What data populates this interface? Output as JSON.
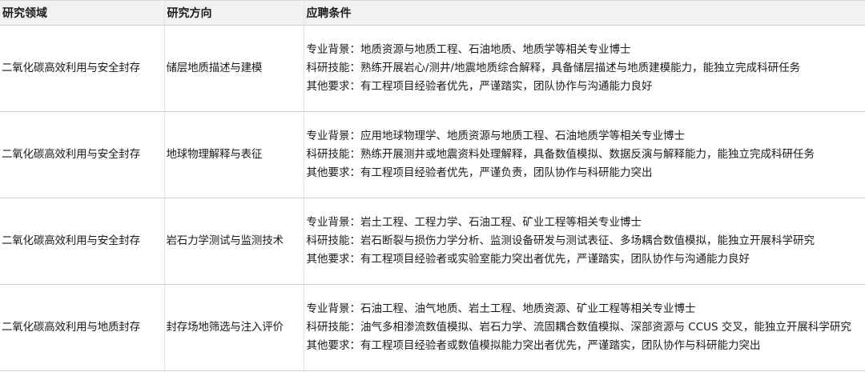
{
  "table": {
    "headers": [
      "研究领域",
      "研究方向",
      "应聘条件"
    ],
    "rows": [
      {
        "area": "二氧化碳高效利用与安全封存",
        "direction": "储层地质描述与建模",
        "requirements": [
          "专业背景：地质资源与地质工程、石油地质、地质学等相关专业博士",
          "科研技能：熟练开展岩心/测井/地震地质综合解释，具备储层描述与地质建模能力，能独立完成科研任务",
          "其他要求：有工程项目经验者优先，严谨踏实，团队协作与沟通能力良好"
        ]
      },
      {
        "area": "二氧化碳高效利用与安全封存",
        "direction": "地球物理解释与表征",
        "requirements": [
          "专业背景：应用地球物理学、地质资源与地质工程、石油地质学等相关专业博士",
          "科研技能：熟练开展测井或地震资料处理解释，具备数值模拟、数据反演与解释能力，能独立完成科研任务",
          "其他要求：有工程项目经验者优先，严谨负责，团队协作与科研能力突出"
        ]
      },
      {
        "area": "二氧化碳高效利用与安全封存",
        "direction": "岩石力学测试与监测技术",
        "requirements": [
          "专业背景：岩土工程、工程力学、石油工程、矿业工程等相关专业博士",
          "科研技能：岩石断裂与损伤力学分析、监测设备研发与测试表征、多场耦合数值模拟，能独立开展科学研究",
          "其他要求：有工程项目经验者或实验室能力突出者优先，严谨踏实，团队协作与沟通能力良好"
        ]
      },
      {
        "area": "二氧化碳高效利用与地质封存",
        "direction": "封存场地筛选与注入评价",
        "requirements": [
          "专业背景：石油工程、油气地质、岩土工程、地质资源、矿业工程等相关专业博士",
          "科研技能：油气多相渗流数值模拟、岩石力学、流固耦合数值模拟、深部资源与 CCUS 交叉，能独立开展科学研究",
          "其他要求：有工程项目经验者或数值模拟能力突出者优先，严谨踏实，团队协作与科研能力突出"
        ]
      }
    ]
  }
}
